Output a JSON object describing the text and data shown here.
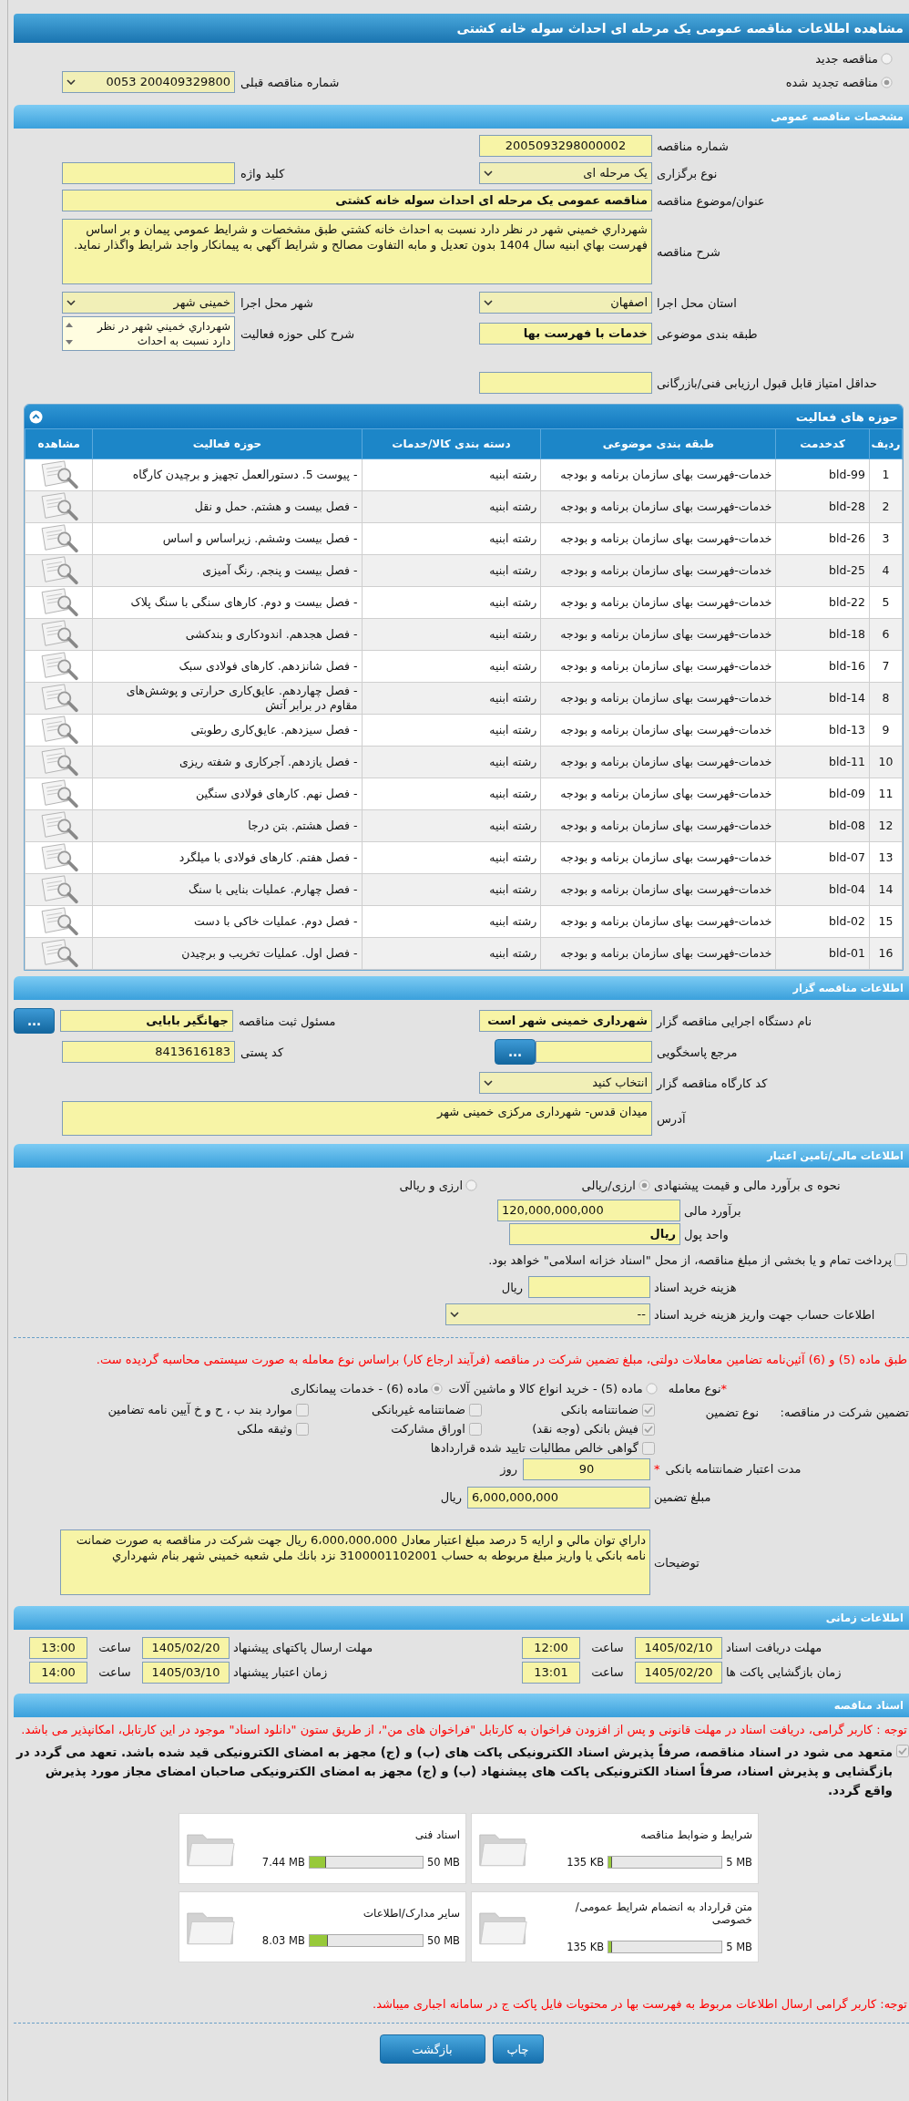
{
  "title": "مشاهده اطلاعات مناقصه عمومی یک مرحله ای احداث سوله خانه کشتی",
  "tender_options": [
    {
      "label": "مناقصه جدید",
      "selected": false
    },
    {
      "label": "مناقصه تجدید شده",
      "selected": true
    }
  ],
  "previous_tender": {
    "label": "شماره مناقصه قبلی",
    "value": "200409329800 0053",
    "kind": "select"
  },
  "general": {
    "header": "مشخصات مناقصه عمومی",
    "rows": [
      {
        "fields": [
          {
            "label": "شماره مناقصه",
            "value": "2005093298000002",
            "kind": "number"
          }
        ]
      },
      {
        "fields": [
          {
            "label": "نوع برگزاری",
            "value": "یک مرحله ای",
            "kind": "select"
          },
          {
            "label": "کلید واژه",
            "kind": "input"
          }
        ]
      },
      {
        "fields": [
          {
            "label": "عنوان/موضوع مناقصه",
            "value": "مناقصه عمومی یک مرحله ای احداث سوله خانه کشتی",
            "kind": "wide",
            "emphasized": true
          }
        ]
      },
      {
        "fields": [
          {
            "label": "شرح مناقصه",
            "value": "شهرداري خميني شهر در نظر دارد نسبت به احداث خانه کشتي طبق مشخصات و شرايط عمومي پيمان و بر اساس فهرست بهاي ابنيه سال 1404 بدون تعديل و مابه التفاوت مصالح  و شرايط آگهي به پيمانكار واجد شرايط واگذار نمايد.",
            "kind": "textarea"
          }
        ]
      },
      {
        "fields": [
          {
            "label": "استان محل اجرا",
            "value": "اصفهان",
            "kind": "select"
          },
          {
            "label": "شهر محل اجرا",
            "value": "خمینی شهر",
            "kind": "select"
          }
        ]
      },
      {
        "fields": [
          {
            "label": "طبقه بندی موضوعی",
            "value": "خدمات با فهرست بها",
            "kind": "input",
            "emphasized": true
          },
          {
            "label": "شرح کلی حوزه فعالیت",
            "value": "شهرداري خميني شهر در نظر دارد نسبت به احداث",
            "kind": "listbox"
          }
        ]
      },
      {
        "fields": [
          {
            "label": "حداقل امتیاز قابل قبول ارزیابی فنی/بازرگانی",
            "kind": "input"
          }
        ]
      }
    ]
  },
  "activities": {
    "header": "حوزه های فعالیت",
    "columns": [
      "ردیف",
      "کدخدمت",
      "طبقه بندی موضوعی",
      "دسته بندی کالا/خدمات",
      "حوزه فعالیت",
      "مشاهده"
    ],
    "rows": [
      {
        "index": "1",
        "code": "bld-99",
        "category": "خدمات-فهرست بهای سازمان برنامه و بودجه",
        "group": "رشته ابنیه",
        "activity": "- پیوست 5. دستورالعمل تجهیز و برچیدن کارگاه"
      },
      {
        "index": "2",
        "code": "bld-28",
        "category": "خدمات-فهرست بهای سازمان برنامه و بودجه",
        "group": "رشته ابنیه",
        "activity": "- فصل بیست و هشتم. حمل و نقل"
      },
      {
        "index": "3",
        "code": "bld-26",
        "category": "خدمات-فهرست بهای سازمان برنامه و بودجه",
        "group": "رشته ابنیه",
        "activity": "- فصل بیست وششم. زیراساس و اساس"
      },
      {
        "index": "4",
        "code": "bld-25",
        "category": "خدمات-فهرست بهای سازمان برنامه و بودجه",
        "group": "رشته ابنیه",
        "activity": "- فصل بیست و پنجم. رنگ آمیزی"
      },
      {
        "index": "5",
        "code": "bld-22",
        "category": "خدمات-فهرست بهای سازمان برنامه و بودجه",
        "group": "رشته ابنیه",
        "activity": "- فصل بیست و دوم. کارهای سنگی با سنگ پلاک"
      },
      {
        "index": "6",
        "code": "bld-18",
        "category": "خدمات-فهرست بهای سازمان برنامه و بودجه",
        "group": "رشته ابنیه",
        "activity": "- فصل هجدهم. اندودکاری و بندکشی"
      },
      {
        "index": "7",
        "code": "bld-16",
        "category": "خدمات-فهرست بهای سازمان برنامه و بودجه",
        "group": "رشته ابنیه",
        "activity": "- فصل شانزدهم. کارهای فولادی سبک"
      },
      {
        "index": "8",
        "code": "bld-14",
        "category": "خدمات-فهرست بهای سازمان برنامه و بودجه",
        "group": "رشته ابنیه",
        "activity": "- فصل چهاردهم. عایق‌کاری حرارتی و پوشش‌های مقاوم در برابر آتش"
      },
      {
        "index": "9",
        "code": "bld-13",
        "category": "خدمات-فهرست بهای سازمان برنامه و بودجه",
        "group": "رشته ابنیه",
        "activity": "- فصل سیزدهم. عایق‌کاری رطوبتی"
      },
      {
        "index": "10",
        "code": "bld-11",
        "category": "خدمات-فهرست بهای سازمان برنامه و بودجه",
        "group": "رشته ابنیه",
        "activity": "- فصل یازدهم. آجرکاری و شفته ریزی"
      },
      {
        "index": "11",
        "code": "bld-09",
        "category": "خدمات-فهرست بهای سازمان برنامه و بودجه",
        "group": "رشته ابنیه",
        "activity": "- فصل نهم. کارهای فولادی سنگین"
      },
      {
        "index": "12",
        "code": "bld-08",
        "category": "خدمات-فهرست بهای سازمان برنامه و بودجه",
        "group": "رشته ابنیه",
        "activity": "- فصل هشتم. بتن درجا"
      },
      {
        "index": "13",
        "code": "bld-07",
        "category": "خدمات-فهرست بهای سازمان برنامه و بودجه",
        "group": "رشته ابنیه",
        "activity": "- فصل هفتم. کارهای فولادی با میلگرد"
      },
      {
        "index": "14",
        "code": "bld-04",
        "category": "خدمات-فهرست بهای سازمان برنامه و بودجه",
        "group": "رشته ابنیه",
        "activity": "- فصل چهارم. عملیات بنایی با سنگ"
      },
      {
        "index": "15",
        "code": "bld-02",
        "category": "خدمات-فهرست بهای سازمان برنامه و بودجه",
        "group": "رشته ابنیه",
        "activity": "- فصل دوم. عملیات خاکی با دست"
      },
      {
        "index": "16",
        "code": "bld-01",
        "category": "خدمات-فهرست بهای سازمان برنامه و بودجه",
        "group": "رشته ابنیه",
        "activity": "- فصل اول. عملیات تخریب و برچیدن"
      }
    ]
  },
  "organizer": {
    "header": "اطلاعات مناقصه گزار",
    "rows": [
      {
        "fields": [
          {
            "label": "نام دستگاه اجرایی مناقصه گزار",
            "value": "شهرداری خمینی شهر است",
            "kind": "input",
            "emphasized": true
          },
          {
            "label": "مسئول ثبت مناقصه",
            "value": "جهانگیر بابایی",
            "kind": "lookup",
            "button": "...",
            "emphasized": true
          }
        ]
      },
      {
        "fields": [
          {
            "label": "مرجع پاسخگویی",
            "kind": "lookup",
            "button": "..."
          },
          {
            "label": "کد پستی",
            "value": "8413616183",
            "kind": "input"
          }
        ]
      },
      {
        "fields": [
          {
            "label": "کد کارگاه مناقصه گزار",
            "value": "انتخاب کنید",
            "kind": "select"
          }
        ]
      },
      {
        "fields": [
          {
            "label": "آدرس",
            "value": "میدان قدس- شهرداری مرکزی خمینی شهر",
            "kind": "address"
          }
        ]
      }
    ]
  },
  "finance": {
    "header": "اطلاعات مالی/تامین اعتبار",
    "method": {
      "label": "نحوه ی برآورد مالی و قیمت پیشنهادی",
      "options": [
        {
          "label": "ارزی/ریالی",
          "selected": true
        },
        {
          "label": "ارزی و ریالی",
          "selected": false
        }
      ]
    },
    "estimate": {
      "label": "برآورد مالی",
      "value": "120,000,000,000"
    },
    "currency": {
      "label": "واحد پول",
      "value": "ریال"
    },
    "treasury": {
      "label": "پرداخت تمام و یا بخشی از مبلغ مناقصه، از محل \"اسناد خزانه اسلامی\" خواهد بود.",
      "checked": false
    },
    "fee": {
      "label": "هزینه خرید اسناد",
      "unit": "ریال"
    },
    "account": {
      "label": "اطلاعات حساب جهت واریز هزینه خرید اسناد",
      "value": "--"
    }
  },
  "guarantee": {
    "notice": "طبق ماده (5) و (6) آئین‌نامه تضامین معاملات دولتی، مبلغ تضمین شرکت در مناقصه (فرآیند ارجاع کار) براساس نوع معامله به صورت سیستمی محاسبه گردیده ست.",
    "transaction": {
      "required_mark": "*",
      "label": "نوع معامله",
      "options": [
        {
          "label": "ماده (5) - خرید انواع کالا و ماشین آلات",
          "selected": false
        },
        {
          "label": "ماده (6) - خدمات پیمانکاری",
          "selected": true
        }
      ]
    },
    "label": "تضمین شرکت در مناقصه:",
    "type_label": "نوع تضمین",
    "options": [
      {
        "label": "ضمانتنامه بانکی",
        "checked": true
      },
      {
        "label": "ضمانتنامه غیربانکی",
        "checked": false
      },
      {
        "label": "موارد بند ب ، ح و خ آیین نامه تضامین",
        "checked": false
      },
      {
        "label": "فیش بانکی (وجه نقد)",
        "checked": true
      },
      {
        "label": "اوراق مشارکت",
        "checked": false
      },
      {
        "label": "وثیقه ملکی",
        "checked": false
      },
      {
        "label": "گواهی خالص مطالبات تایید شده قراردادها",
        "checked": false
      }
    ],
    "duration": {
      "required_mark": "*",
      "label": "مدت اعتبار ضمانتنامه بانکی",
      "value": "90",
      "unit": "روز"
    },
    "amount": {
      "label": "مبلغ تضمین",
      "value": "6,000,000,000",
      "unit": "ریال"
    },
    "notes": {
      "label": "توضیحات",
      "value": "داراي توان مالي و ارايه 5 درصد مبلغ اعتبار معادل 6،000،000،000 ريال جهت شركت در مناقصه به صورت ضمانت نامه بانكي يا واريز مبلغ مربوطه به حساب 3100001102001 نزد بانك ملي شعبه خميني شهر بنام شهرداري"
    }
  },
  "timing": {
    "header": "اطلاعات زمانی",
    "rows": [
      [
        {
          "label": "مهلت دریافت اسناد",
          "date": "1405/02/10",
          "time_label": "ساعت",
          "time": "12:00"
        },
        {
          "label": "مهلت ارسال پاکتهای پیشنهاد",
          "date": "1405/02/20",
          "time_label": "ساعت",
          "time": "13:00"
        }
      ],
      [
        {
          "label": "زمان بازگشایی پاکت ها",
          "date": "1405/02/20",
          "time_label": "ساعت",
          "time": "13:01"
        },
        {
          "label": "زمان اعتبار پیشنهاد",
          "date": "1405/03/10",
          "time_label": "ساعت",
          "time": "14:00"
        }
      ]
    ]
  },
  "documents": {
    "header": "اسناد مناقصه",
    "notice": "توجه : کاربر گرامی، دریافت اسناد در مهلت قانونی و پس از افزودن فراخوان به کارتابل \"فراخوان های من\"، از طریق ستون \"دانلود اسناد\" موجود در این کارتابل، امکانپذیر می باشد.",
    "commitment": {
      "text": "متعهد می شود در اسناد مناقصه، صرفاً پذیرش اسناد الکترونیکی پاکت های (ب) و (ج) مجهز به امضای الکترونیکی قید شده باشد. تعهد می گردد در بازگشایی و پذیرش اسناد، صرفاً اسناد الکترونیکی پاکت های پیشنهاد (ب) و (ج) مجهز به امضای الکترونیکی صاحبان امضای مجاز مورد پذیرش واقع گردد.",
      "checked": true
    },
    "files": [
      {
        "title": "شرایط و ضوابط مناقصه",
        "max": "5 MB",
        "size": "135 KB",
        "level": 0.03
      },
      {
        "title": "اسناد فنی",
        "max": "50 MB",
        "size": "7.44 MB",
        "level": 0.15
      },
      {
        "title": "متن قرارداد به انضمام شرایط عمومی/خصوصی",
        "max": "5 MB",
        "size": "135 KB",
        "level": 0.03
      },
      {
        "title": "سایر مدارک/اطلاعات",
        "max": "50 MB",
        "size": "8.03 MB",
        "level": 0.16
      }
    ],
    "footer_notice": "توجه: کاربر گرامی ارسال اطلاعات مربوط به فهرست بها در محتویات فایل پاکت ج در سامانه اجباری میباشد."
  },
  "buttons": [
    "چاپ",
    "بازگشت"
  ]
}
